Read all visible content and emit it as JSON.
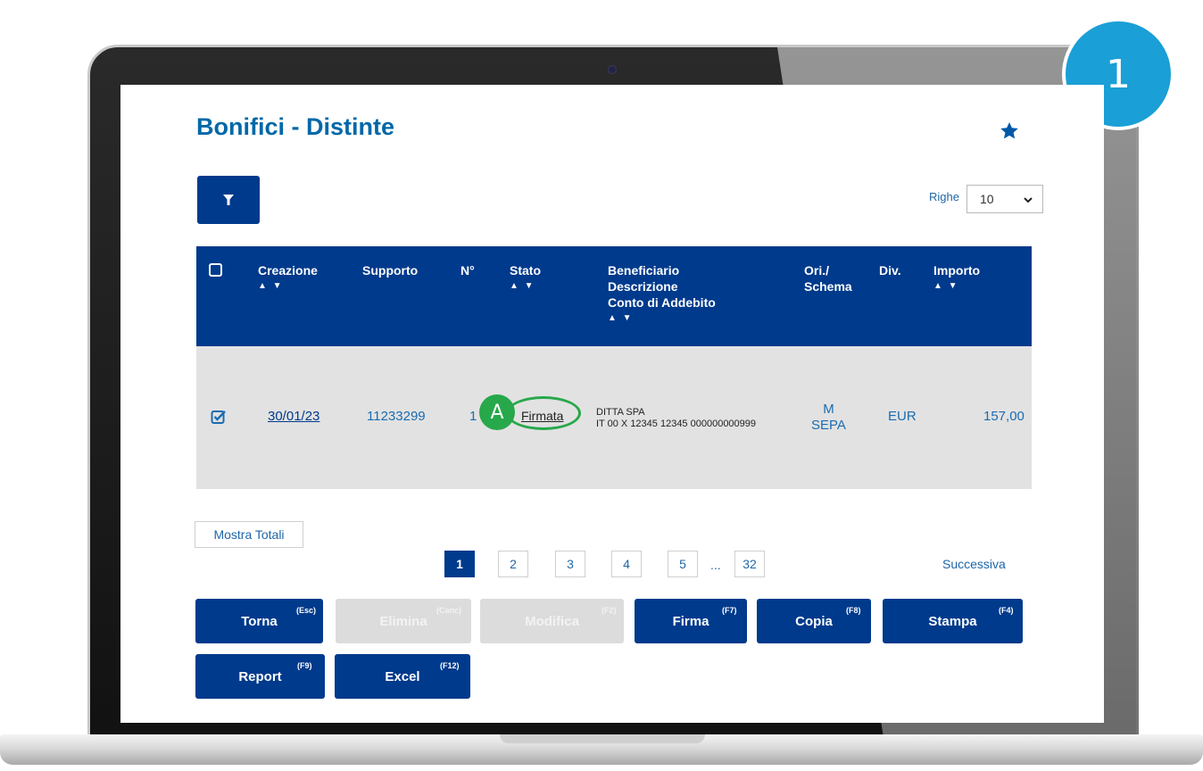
{
  "step_badge": "1",
  "page": {
    "title": "Bonifici - Distinte"
  },
  "rows_selector": {
    "label": "Righe",
    "value": "10"
  },
  "table": {
    "headers": {
      "creazione": "Creazione",
      "supporto": "Supporto",
      "numero": "N°",
      "stato": "Stato",
      "beneficiario_1": "Beneficiario",
      "beneficiario_2": "Descrizione",
      "beneficiario_3": "Conto di Addebito",
      "ori_1": "Ori./",
      "ori_2": "Schema",
      "div": "Div.",
      "importo": "Importo",
      "sort": "▲ ▼"
    },
    "row": {
      "creazione": "30/01/23",
      "supporto": "11233299",
      "numero": "1",
      "stato": "Firmata",
      "marker": "A",
      "beneficiario_name": "DITTA SPA",
      "beneficiario_iban": "IT 00 X 12345 12345 000000000999",
      "ori": "M",
      "schema": "SEPA",
      "div": "EUR",
      "importo": "157,00"
    }
  },
  "totals_button": "Mostra Totali",
  "pagination": {
    "pages": [
      "1",
      "2",
      "3",
      "4",
      "5"
    ],
    "ellipsis": "...",
    "last": "32",
    "next": "Successiva"
  },
  "actions": {
    "torna": {
      "label": "Torna",
      "key": "(Esc)"
    },
    "elimina": {
      "label": "Elimina",
      "key": "(Canc)"
    },
    "modifica": {
      "label": "Modifica",
      "key": "(F2)"
    },
    "firma": {
      "label": "Firma",
      "key": "(F7)"
    },
    "copia": {
      "label": "Copia",
      "key": "(F8)"
    },
    "stampa": {
      "label": "Stampa",
      "key": "(F4)"
    },
    "report": {
      "label": "Report",
      "key": "(F9)"
    },
    "excel": {
      "label": "Excel",
      "key": "(F12)"
    }
  },
  "colors": {
    "primary": "#003a8c",
    "title": "#0068a8",
    "highlight": "#27a84a",
    "step": "#1a9fd6"
  }
}
